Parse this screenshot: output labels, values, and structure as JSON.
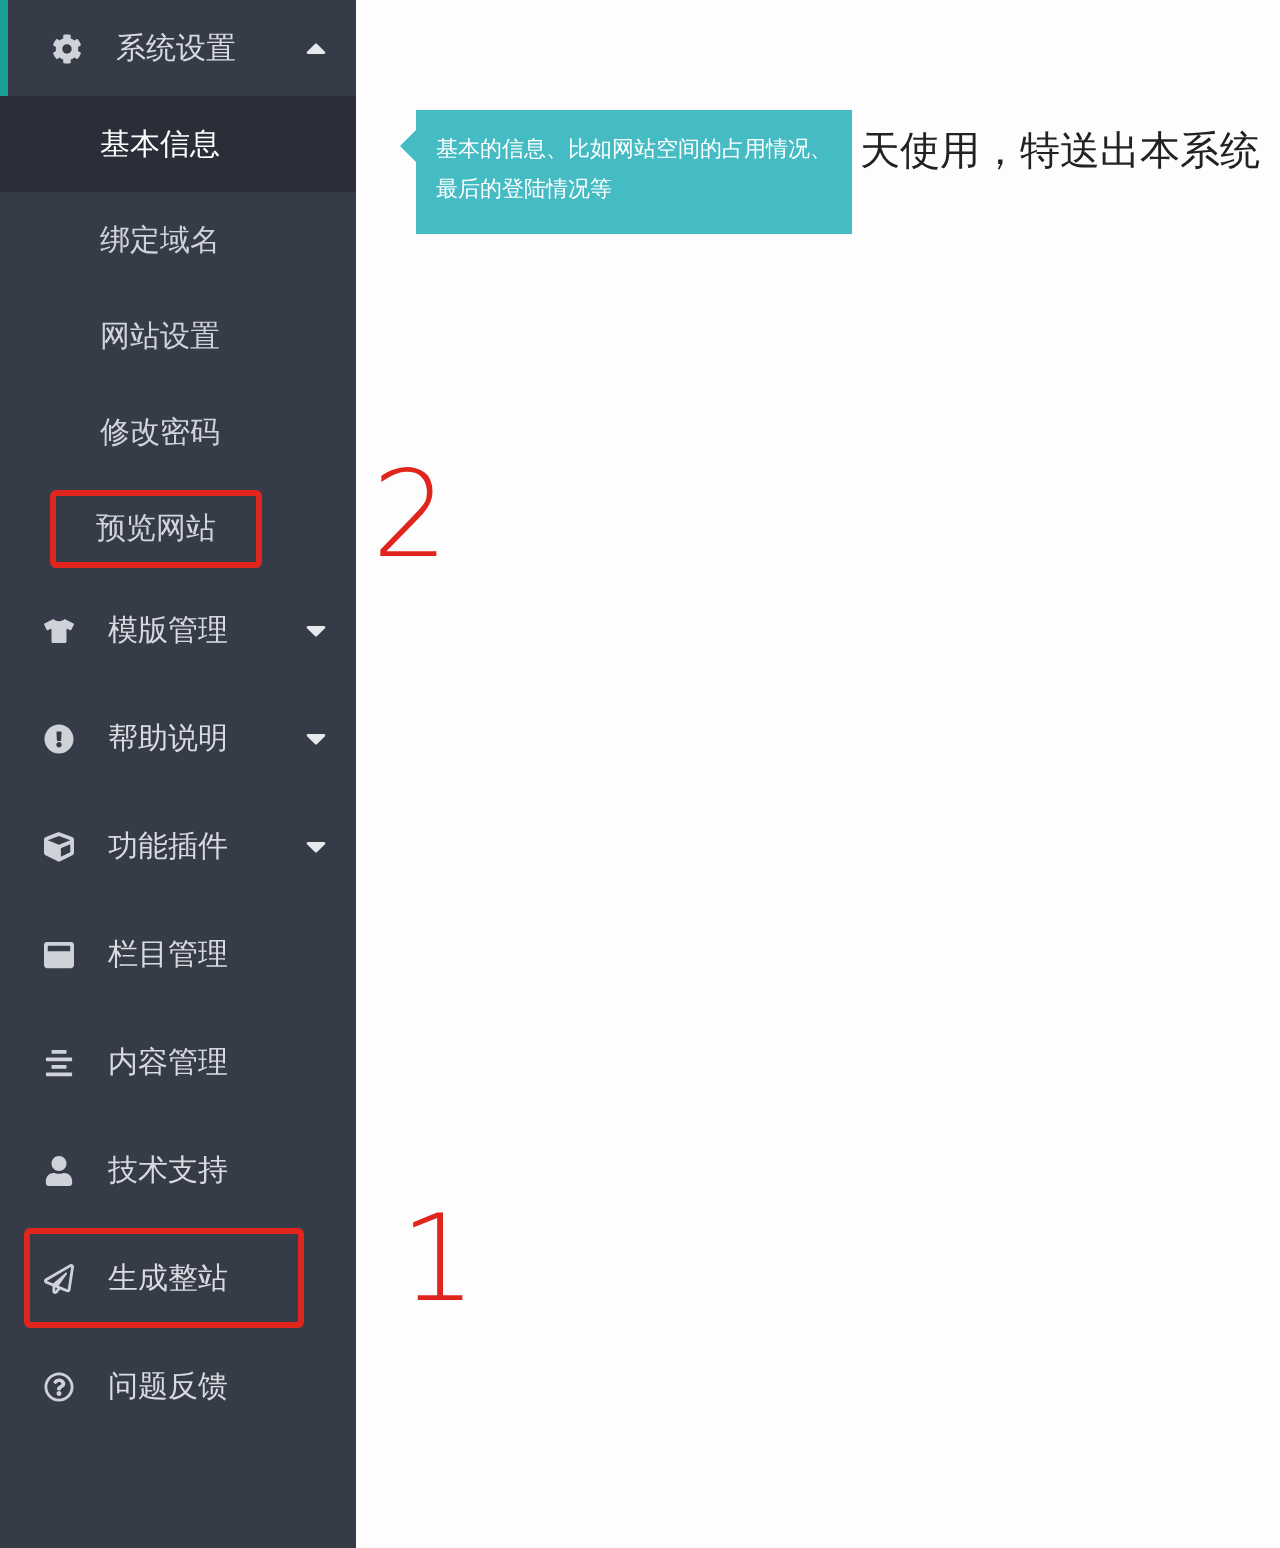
{
  "sidebar": {
    "menus": [
      {
        "kind": "group",
        "label": "系统设置",
        "expanded": true,
        "highlighted": false,
        "children": [
          {
            "label": "基本信息",
            "selected": true,
            "highlighted": false
          },
          {
            "label": "绑定域名",
            "selected": false,
            "highlighted": false
          },
          {
            "label": "网站设置",
            "selected": false,
            "highlighted": false
          },
          {
            "label": "修改密码",
            "selected": false,
            "highlighted": false
          },
          {
            "label": "预览网站",
            "selected": false,
            "highlighted": true
          }
        ]
      },
      {
        "kind": "group",
        "label": "模版管理",
        "expanded": false,
        "highlighted": false
      },
      {
        "kind": "group",
        "label": "帮助说明",
        "expanded": false,
        "highlighted": false
      },
      {
        "kind": "group",
        "label": "功能插件",
        "expanded": false,
        "highlighted": false
      },
      {
        "kind": "link",
        "label": "栏目管理",
        "highlighted": false
      },
      {
        "kind": "link",
        "label": "内容管理",
        "highlighted": false
      },
      {
        "kind": "link",
        "label": "技术支持",
        "highlighted": false
      },
      {
        "kind": "link",
        "label": "生成整站",
        "highlighted": true
      },
      {
        "kind": "link",
        "label": "问题反馈",
        "highlighted": false
      }
    ]
  },
  "content": {
    "message": "天使用，特送出本系统",
    "tooltip": "基本的信息、比如网站空间的占用情况、最后的登陆情况等"
  },
  "annotations": [
    {
      "text": "2"
    },
    {
      "text": "1"
    }
  ]
}
